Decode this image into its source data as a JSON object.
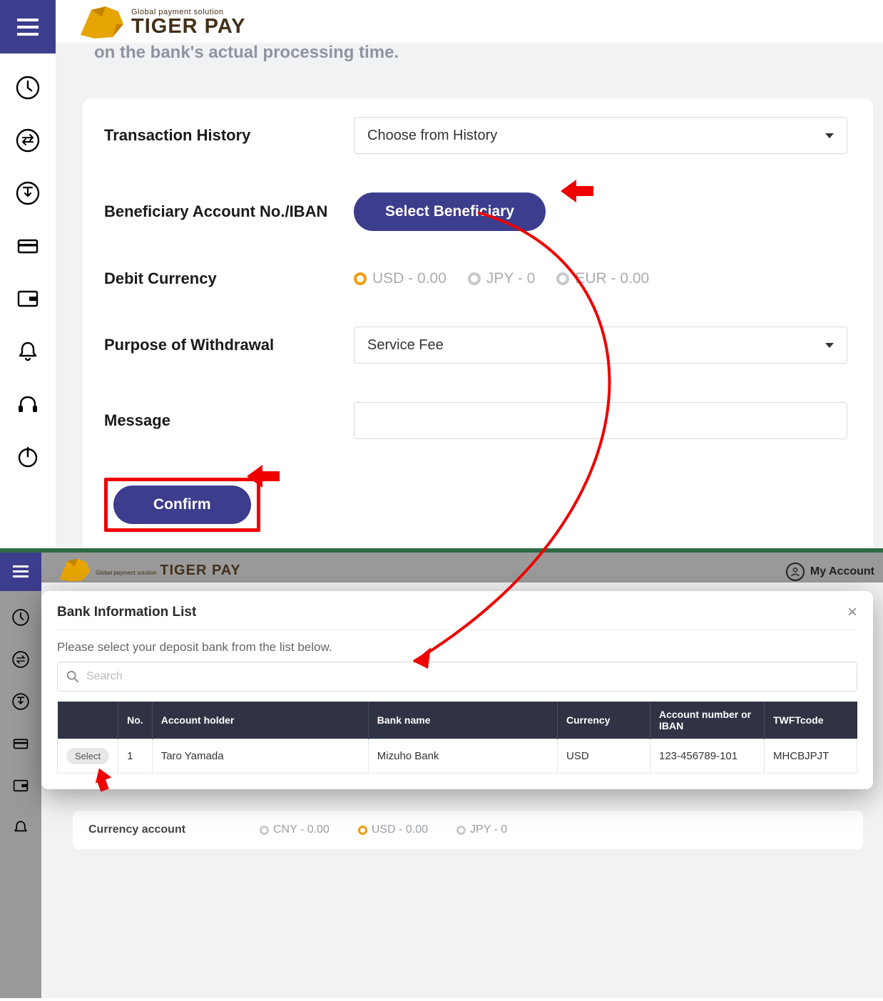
{
  "top": {
    "logo_tag": "Global payment solution",
    "logo_name": "TIGER PAY",
    "partial_banner": "on the bank's actual processing time.",
    "form": {
      "history_label": "Transaction History",
      "history_placeholder": "Choose from History",
      "beneficiary_label": "Beneficiary Account No./IBAN",
      "select_beneficiary_btn": "Select Beneficiary",
      "debit_label": "Debit Currency",
      "debit_options": [
        {
          "label": "USD - 0.00",
          "checked": true
        },
        {
          "label": "JPY - 0",
          "checked": false
        },
        {
          "label": "EUR - 0.00",
          "checked": false
        }
      ],
      "purpose_label": "Purpose of Withdrawal",
      "purpose_value": "Service Fee",
      "message_label": "Message",
      "message_value": "",
      "confirm_btn": "Confirm"
    }
  },
  "bot": {
    "my_account": "My Account",
    "currency_label": "Currency account",
    "currency_options": [
      {
        "label": "CNY - 0.00",
        "checked": false
      },
      {
        "label": "USD - 0.00",
        "checked": true
      },
      {
        "label": "JPY - 0",
        "checked": false
      }
    ],
    "modal": {
      "title": "Bank Information List",
      "subtitle": "Please select your deposit bank from the list below.",
      "search_placeholder": "Search",
      "columns": {
        "select": "",
        "no": "No.",
        "holder": "Account holder",
        "bank": "Bank name",
        "currency": "Currency",
        "iban": "Account number or IBAN",
        "swift": "TWFTcode"
      },
      "select_chip": "Select",
      "rows": [
        {
          "no": "1",
          "holder": "Taro Yamada",
          "bank": "Mizuho Bank",
          "currency": "USD",
          "iban": "123-456789-101",
          "swift": "MHCBJPJT"
        }
      ]
    }
  }
}
